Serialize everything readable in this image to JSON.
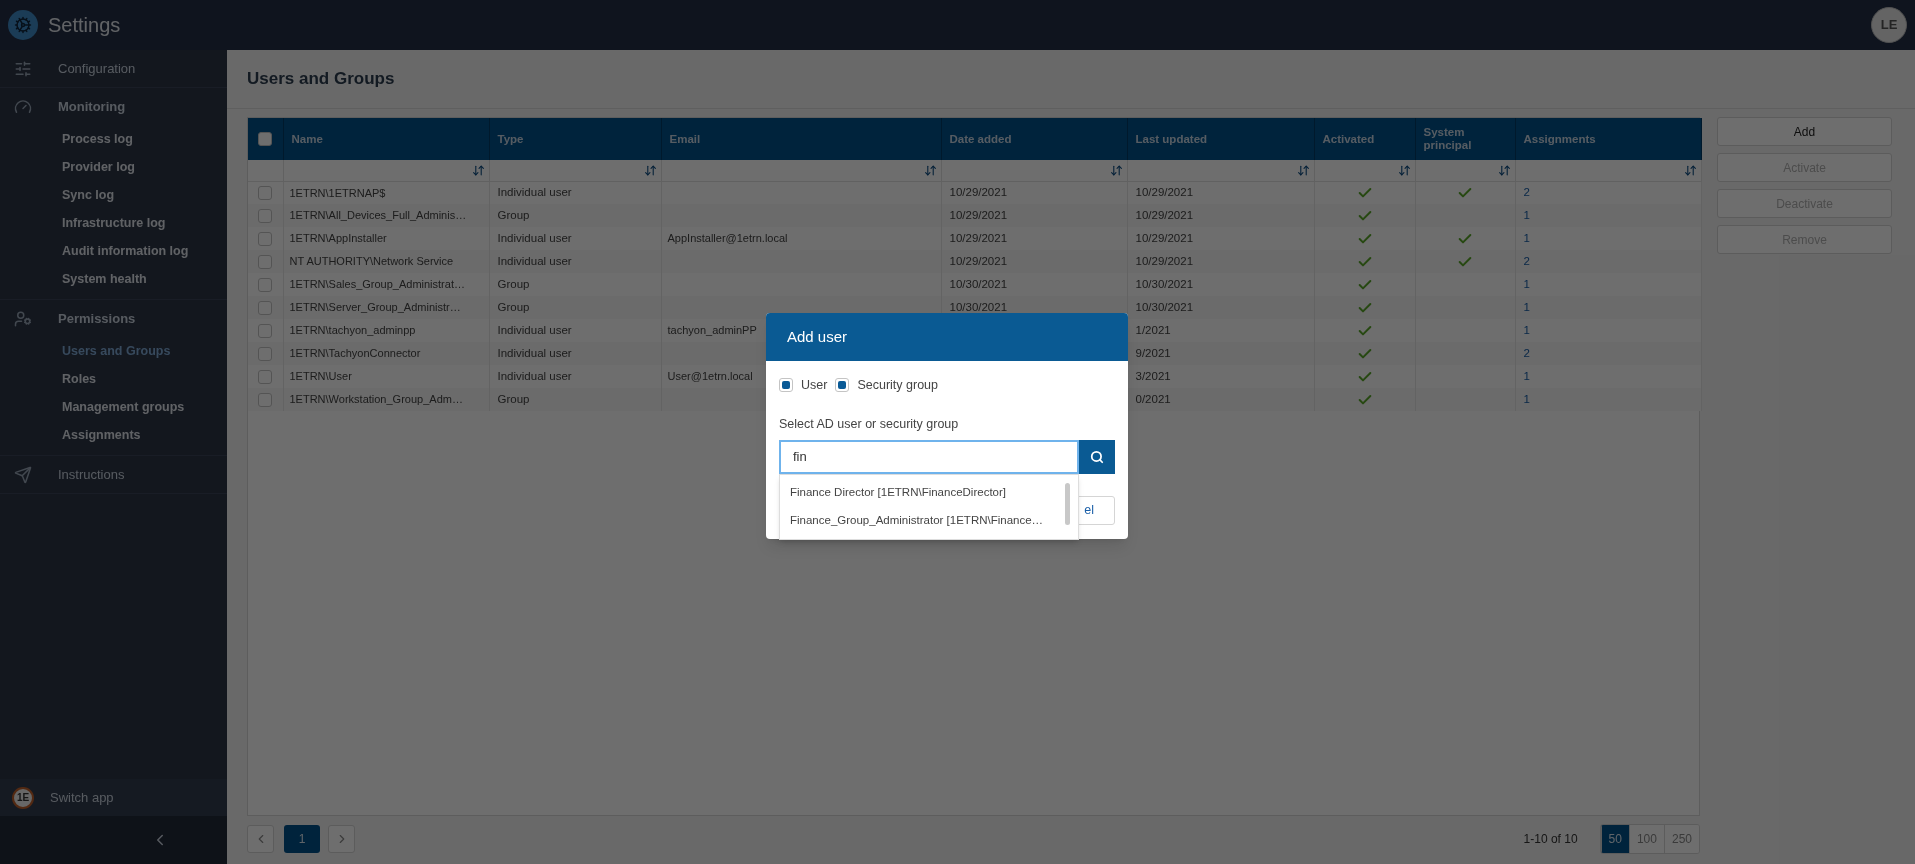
{
  "top_bar": {
    "title": "Settings",
    "avatar": "LE"
  },
  "sidebar": {
    "sections": [
      {
        "label": "Configuration"
      },
      {
        "label": "Monitoring",
        "children": [
          {
            "label": "Process log",
            "selected": false
          },
          {
            "label": "Provider log",
            "selected": false
          },
          {
            "label": "Sync log",
            "selected": false
          },
          {
            "label": "Infrastructure log",
            "selected": false
          },
          {
            "label": "Audit information log",
            "selected": false
          },
          {
            "label": "System health",
            "selected": false
          }
        ]
      },
      {
        "label": "Permissions",
        "children": [
          {
            "label": "Users and Groups",
            "selected": true
          },
          {
            "label": "Roles",
            "selected": false
          },
          {
            "label": "Management groups",
            "selected": false
          },
          {
            "label": "Assignments",
            "selected": false
          }
        ]
      },
      {
        "label": "Instructions"
      }
    ],
    "switch_app": {
      "logo": "1E",
      "label": "Switch app"
    }
  },
  "page": {
    "title": "Users and Groups"
  },
  "table": {
    "select_all_checked": false,
    "columns": [
      "Name",
      "Type",
      "Email",
      "Date added",
      "Last updated",
      "Activated",
      "System principal",
      "Assignments"
    ],
    "rows": [
      {
        "checked": false,
        "name": "1ETRN\\1ETRNAP$",
        "type": "Individual user",
        "email": "",
        "date_added": "10/29/2021",
        "last_updated": "10/29/2021",
        "activated": true,
        "system_principal": true,
        "assignments": "2"
      },
      {
        "checked": false,
        "name": "1ETRN\\All_Devices_Full_Adminis…",
        "type": "Group",
        "email": "",
        "date_added": "10/29/2021",
        "last_updated": "10/29/2021",
        "activated": true,
        "system_principal": false,
        "assignments": "1"
      },
      {
        "checked": false,
        "name": "1ETRN\\AppInstaller",
        "type": "Individual user",
        "email": "AppInstaller@1etrn.local",
        "date_added": "10/29/2021",
        "last_updated": "10/29/2021",
        "activated": true,
        "system_principal": true,
        "assignments": "1"
      },
      {
        "checked": false,
        "name": "NT AUTHORITY\\Network Service",
        "type": "Individual user",
        "email": "",
        "date_added": "10/29/2021",
        "last_updated": "10/29/2021",
        "activated": true,
        "system_principal": true,
        "assignments": "2"
      },
      {
        "checked": false,
        "name": "1ETRN\\Sales_Group_Administrat…",
        "type": "Group",
        "email": "",
        "date_added": "10/30/2021",
        "last_updated": "10/30/2021",
        "activated": true,
        "system_principal": false,
        "assignments": "1"
      },
      {
        "checked": false,
        "name": "1ETRN\\Server_Group_Administr…",
        "type": "Group",
        "email": "",
        "date_added": "10/30/2021",
        "last_updated": "10/30/2021",
        "activated": true,
        "system_principal": false,
        "assignments": "1"
      },
      {
        "checked": false,
        "name": "1ETRN\\tachyon_adminpp",
        "type": "Individual user",
        "email": "tachyon_adminPP",
        "date_added": "",
        "last_updated": "1/2021",
        "activated": true,
        "system_principal": false,
        "assignments": "1"
      },
      {
        "checked": false,
        "name": "1ETRN\\TachyonConnector",
        "type": "Individual user",
        "email": "",
        "date_added": "",
        "last_updated": "9/2021",
        "activated": true,
        "system_principal": false,
        "assignments": "2"
      },
      {
        "checked": false,
        "name": "1ETRN\\User",
        "type": "Individual user",
        "email": "User@1etrn.local",
        "date_added": "",
        "last_updated": "3/2021",
        "activated": true,
        "system_principal": false,
        "assignments": "1"
      },
      {
        "checked": false,
        "name": "1ETRN\\Workstation_Group_Adm…",
        "type": "Group",
        "email": "",
        "date_added": "",
        "last_updated": "0/2021",
        "activated": true,
        "system_principal": false,
        "assignments": "1"
      }
    ]
  },
  "actions": [
    {
      "label": "Add",
      "disabled": false
    },
    {
      "label": "Activate",
      "disabled": true
    },
    {
      "label": "Deactivate",
      "disabled": true
    },
    {
      "label": "Remove",
      "disabled": true
    }
  ],
  "pagination": {
    "pages": [
      {
        "label": "1",
        "selected": true
      }
    ],
    "range": "1-10 of 10",
    "page_sizes": [
      {
        "label": "50",
        "selected": true
      },
      {
        "label": "100",
        "selected": false
      },
      {
        "label": "250",
        "selected": false
      }
    ]
  },
  "dialog": {
    "title": "Add user",
    "filters": [
      {
        "label": "User",
        "checked": true
      },
      {
        "label": "Security group",
        "checked": true
      }
    ],
    "search_label": "Select AD user or security group",
    "search_value": "fin",
    "suggestions": [
      "Finance Director [1ETRN\\FinanceDirector]",
      "Finance_Group_Administrator [1ETRN\\Finance…"
    ],
    "cancel_visible_text": "el"
  }
}
